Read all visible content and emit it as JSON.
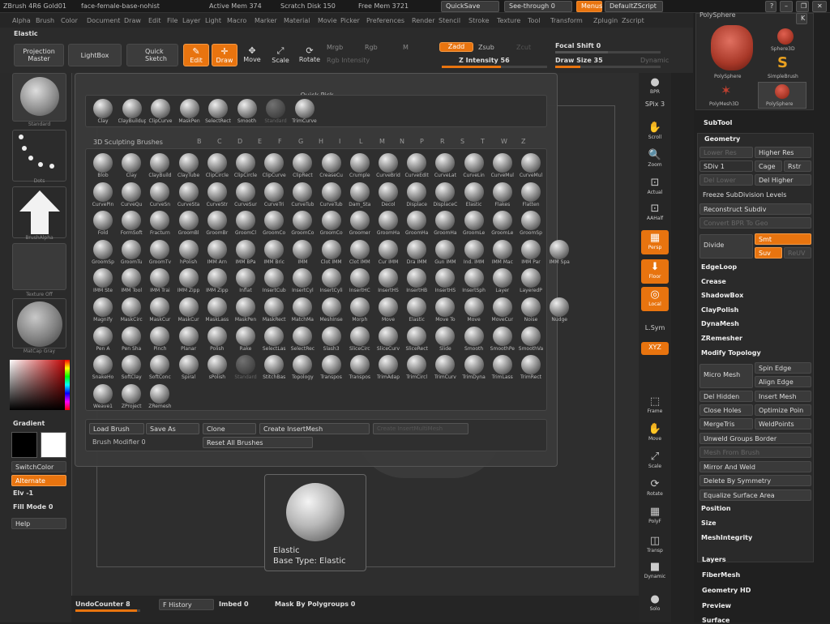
{
  "titlebar": {
    "app": "ZBrush 4R6 Gold01",
    "doc": "face-female-base-nohist",
    "active_mem": "Active Mem 374",
    "scratch": "Scratch Disk 150",
    "free_mem": "Free Mem 3721",
    "quicksave": "QuickSave",
    "seethrough": "See-through",
    "seethrough_val": "0",
    "menus": "Menus",
    "script": "DefaultZScript"
  },
  "menus": [
    "Alpha",
    "Brush",
    "Color",
    "Document",
    "Draw",
    "Edit",
    "File",
    "Layer",
    "Light",
    "Macro",
    "Marker",
    "Material",
    "Movie",
    "Picker",
    "Preferences",
    "Render",
    "Stencil",
    "Stroke",
    "Texture",
    "Tool",
    "Transform",
    "Zplugin",
    "Zscript"
  ],
  "toolbar": {
    "current_brush": "Elastic",
    "projection_master": "Projection Master",
    "lightbox": "LightBox",
    "quick_sketch": "Quick Sketch",
    "edit": "Edit",
    "draw": "Draw",
    "move": "Move",
    "scale": "Scale",
    "rotate": "Rotate",
    "mrgb": "Mrgb",
    "rgb": "Rgb",
    "m": "M",
    "rgb_intensity": "Rgb Intensity",
    "zadd": "Zadd",
    "zsub": "Zsub",
    "zcut": "Zcut",
    "z_intensity": "Z Intensity 56",
    "z_intensity_value": 56,
    "focal_shift": "Focal Shift 0",
    "draw_size": "Draw Size 35",
    "dynamic": "Dynamic"
  },
  "left_shelf": {
    "brush_label": "Standard",
    "stroke_label": "Dots",
    "alpha_label": "BrushAlpha",
    "texture_label": "Texture Off",
    "material_label": "MatCap Gray",
    "gradient": "Gradient",
    "switch_color": "SwitchColor",
    "alternate": "Alternate",
    "elv": "Elv -1",
    "fill_mode": "Fill Mode 0",
    "help": "Help"
  },
  "quick_pick": {
    "title": "Quick Pick",
    "items": [
      "Clay",
      "ClayBuildup",
      "ClipCurve",
      "MaskPen",
      "SelectRect",
      "Smooth",
      "Standard",
      "TrimCurve"
    ],
    "disabled": [
      "Standard"
    ]
  },
  "sculpt": {
    "title": "3D Sculpting Brushes",
    "letters": [
      "B",
      "C",
      "D",
      "E",
      "F",
      "G",
      "H",
      "I",
      "L",
      "M",
      "N",
      "P",
      "R",
      "S",
      "T",
      "W",
      "Z"
    ],
    "rows": [
      [
        "Blob",
        "Clay",
        "ClayBuild",
        "ClayTube",
        "ClipCircle",
        "ClipCircle",
        "ClipCurve",
        "ClipRect",
        "CreaseCu",
        "Crumple",
        "CurveBrid",
        "CurveEdit",
        "CurveLat",
        "CurveLin",
        "CurveMul",
        "CurveMul"
      ],
      [
        "CurvePin",
        "CurveQu",
        "CurveSn",
        "CurveSta",
        "CurveStr",
        "CurveSur",
        "CurveTri",
        "CurveTub",
        "CurveTub",
        "Dam_Sta",
        "Decol",
        "Displace",
        "DisplaceC",
        "Elastic",
        "Flakes",
        "Flatten"
      ],
      [
        "Fold",
        "FormSoft",
        "Fracturn",
        "GroomBl",
        "GroomBr",
        "GroomCl",
        "GroomCo",
        "GroomCo",
        "GroomCo",
        "Groomer",
        "GroomHa",
        "GroomHa",
        "GroomHa",
        "GroomLe",
        "GroomLe",
        "GroomSp"
      ],
      [
        "GroomSp",
        "GroomTu",
        "GroomTv",
        "hPolish",
        "IMM Arn",
        "IMM BPa",
        "IMM Bric",
        "IMM",
        "Clot IMM",
        "Clot IMM",
        "Cur IMM",
        "Dra IMM",
        "Gun IMM",
        "Ind. IMM",
        "IMM Mac",
        "IMM Par",
        "IMM Spa"
      ],
      [
        "IMM Ste",
        "IMM Tool",
        "IMM Trai",
        "IMM Zipp",
        "IMM Zipp",
        "Inflat",
        "InsertCub",
        "InsertCyl",
        "InsertCyli",
        "InsertHC",
        "InsertHS",
        "InsertHB",
        "InsertHS",
        "InsertSph",
        "Layer",
        "LayeredP"
      ],
      [
        "Magnify",
        "MaskCirc",
        "MaskCur",
        "MaskCur",
        "MaskLass",
        "MaskPen",
        "MaskRect",
        "MatchMa",
        "MeshInse",
        "Morph",
        "Move",
        "Elastic",
        "Move To",
        "Move",
        "MoveCur",
        "Noise",
        "Nudge"
      ],
      [
        "Pen A",
        "Pen Sha",
        "Pinch",
        "Planar",
        "Polish",
        "Rake",
        "SelectLas",
        "SelectRec",
        "Slash3",
        "SliceCirc",
        "SliceCurv",
        "SliceRect",
        "Slide",
        "Smooth",
        "SmoothPe",
        "SmoothVa"
      ],
      [
        "SnakeHo",
        "SoftClay",
        "SoftConc",
        "Spiral",
        "sPolish",
        "Standard",
        "StitchBas",
        "Topology",
        "Transpos",
        "Transpos",
        "TrimAdap",
        "TrimCircl",
        "TrimCurv",
        "TrimDyna",
        "TrimLass",
        "TrimRect"
      ],
      [
        "Weave1",
        "ZProject",
        "ZRemesh"
      ]
    ],
    "disabled": [
      "Standard"
    ]
  },
  "popup_footer": {
    "load_brush": "Load Brush",
    "save_as": "Save As",
    "clone": "Clone",
    "create_insertmesh": "Create InsertMesh",
    "create_insertmultimesh": "Create InsertMultiMesh",
    "brush_modifier": "Brush Modifier 0",
    "reset_all": "Reset All Brushes"
  },
  "tooltip": {
    "name": "Elastic",
    "base_type": "Base Type: Elastic"
  },
  "right_shelf": [
    {
      "label": "BPR",
      "active": false
    },
    {
      "label": "SPix 3",
      "active": false
    },
    {
      "label": "Scroll",
      "active": false
    },
    {
      "label": "Zoom",
      "active": false
    },
    {
      "label": "Actual",
      "active": false
    },
    {
      "label": "AAHalf",
      "active": false
    },
    {
      "label": "Persp",
      "active": true
    },
    {
      "label": "Floor",
      "active": true
    },
    {
      "label": "Local",
      "active": true
    },
    {
      "label": "L.Sym",
      "active": false
    },
    {
      "label": "XYZ",
      "active": true
    },
    {
      "label": "Frame",
      "active": false
    },
    {
      "label": "Move",
      "active": false
    },
    {
      "label": "Scale",
      "active": false
    },
    {
      "label": "Rotate",
      "active": false
    },
    {
      "label": "PolyF",
      "active": false
    },
    {
      "label": "Transp",
      "active": false
    },
    {
      "label": "Dynamic",
      "active": false
    },
    {
      "label": "Solo",
      "active": false
    }
  ],
  "palette": {
    "header": "PolySphere",
    "tools": [
      "PolySphere",
      "Sphere3D",
      "SimpleBrush",
      "PolyMesh3D",
      "PolySphere"
    ],
    "subtool": "SubTool",
    "geometry": "Geometry",
    "lower_res": "Lower Res",
    "higher_res": "Higher Res",
    "sdiv": "SDiv 1",
    "cage": "Cage",
    "rstr": "Rstr",
    "del_lower": "Del Lower",
    "del_higher": "Del Higher",
    "freeze": "Freeze SubDivision Levels",
    "reconstruct": "Reconstruct Subdiv",
    "convert_bpr": "Convert BPR To Geo",
    "divide": "Divide",
    "smt": "Smt",
    "suv": "Suv",
    "reuv": "ReUV",
    "edgeloop": "EdgeLoop",
    "crease": "Crease",
    "shadowbox": "ShadowBox",
    "claypolish": "ClayPolish",
    "dynamesh": "DynaMesh",
    "zremesher": "ZRemesher",
    "modify_topology": "Modify Topology",
    "micro_mesh": "Micro Mesh",
    "spin_edge": "Spin Edge",
    "align_edge": "Align Edge",
    "del_hidden": "Del Hidden",
    "insert_mesh": "Insert Mesh",
    "close_holes": "Close Holes",
    "optimize_points": "Optimize Poin",
    "mergetris": "MergeTris",
    "weldpoints": "WeldPoints",
    "unweld_groups": "Unweld Groups Border",
    "mesh_from_brush": "Mesh From Brush",
    "mirror_weld": "Mirror And Weld",
    "delete_symmetry": "Delete By Symmetry",
    "equalize": "Equalize Surface Area",
    "position": "Position",
    "size": "Size",
    "meshintegrity": "MeshIntegrity",
    "layers": "Layers",
    "fibermesh": "FiberMesh",
    "geometry_hd": "Geometry HD",
    "preview": "Preview",
    "surface": "Surface"
  },
  "bottom": {
    "undo": "UndoCounter 8",
    "f_history": "F History",
    "imbed": "Imbed 0",
    "mask_polygroups": "Mask By Polygroups 0"
  },
  "colors": {
    "accent": "#e8740f"
  }
}
